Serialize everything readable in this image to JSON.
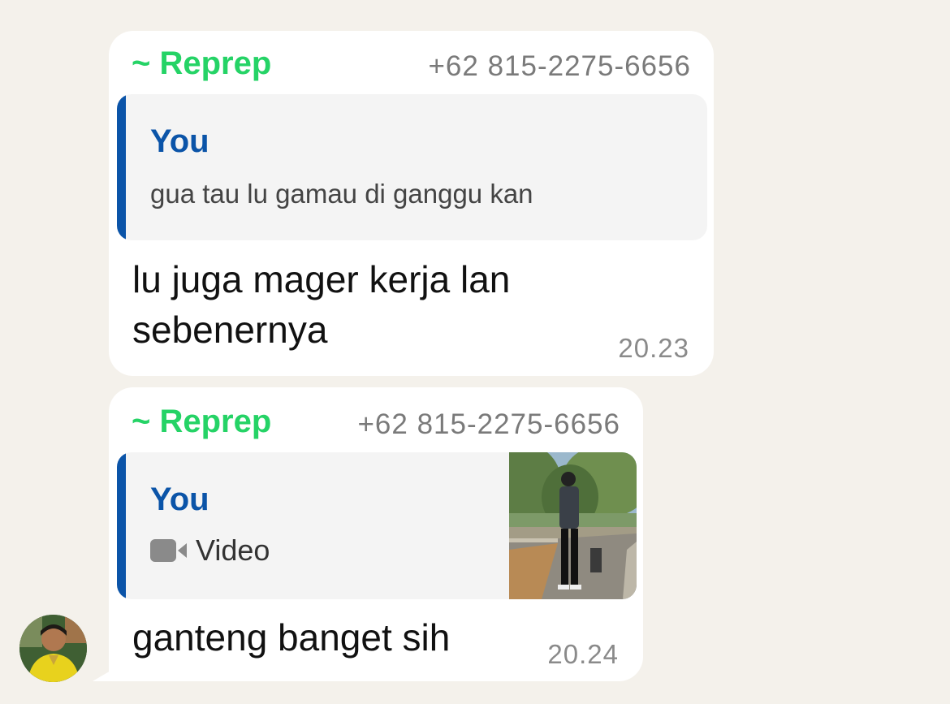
{
  "messages": [
    {
      "sender": "~ Reprep",
      "phone": "+62 815-2275-6656",
      "quote": {
        "author": "You",
        "text": "gua tau lu gamau di ganggu kan"
      },
      "body_line1": "lu juga mager kerja lan",
      "body_line2": "sebenernya",
      "time": "20.23"
    },
    {
      "sender": "~ Reprep",
      "phone": "+62 815-2275-6656",
      "quote": {
        "author": "You",
        "type_label": "Video",
        "icon": "video-camera-icon"
      },
      "body": "ganteng banget sih",
      "time": "20.24"
    }
  ],
  "colors": {
    "background": "#f4f1eb",
    "bubble": "#ffffff",
    "sender": "#25d366",
    "quote_accent": "#0b54a8",
    "quote_bg": "#f4f4f4",
    "meta_text": "#7a7a7a"
  }
}
